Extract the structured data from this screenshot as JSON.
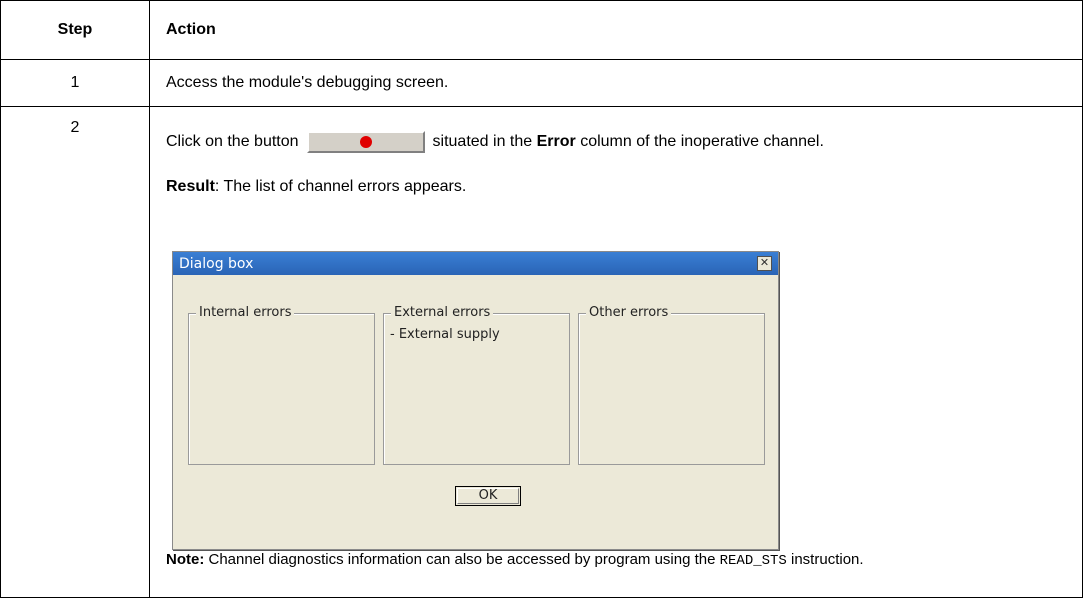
{
  "headers": {
    "step": "Step",
    "action": "Action"
  },
  "rows": [
    {
      "step": "1",
      "action": "Access the module's debugging screen."
    },
    {
      "step": "2"
    }
  ],
  "step2": {
    "click_prefix": "Click on the button",
    "click_suffix_pre": "situated in the",
    "click_bold": "Error",
    "click_suffix_post": "column of the inoperative channel.",
    "result_label": "Result",
    "result_text": ": The list of channel errors appears.",
    "note_label": "Note:",
    "note_text_pre": " Channel diagnostics information can also be accessed by program using the ",
    "note_code": "READ_STS",
    "note_text_post": " instruction."
  },
  "dialog": {
    "title": "Dialog box",
    "close_glyph": "✕",
    "groups": [
      {
        "label": "Internal errors",
        "items": []
      },
      {
        "label": "External errors",
        "items": [
          "- External supply"
        ]
      },
      {
        "label": "Other errors",
        "items": []
      }
    ],
    "ok_label": "OK"
  },
  "colors": {
    "title_bar": "#2a64b6",
    "error_dot": "#e00000",
    "dialog_bg": "#ece9d8"
  }
}
